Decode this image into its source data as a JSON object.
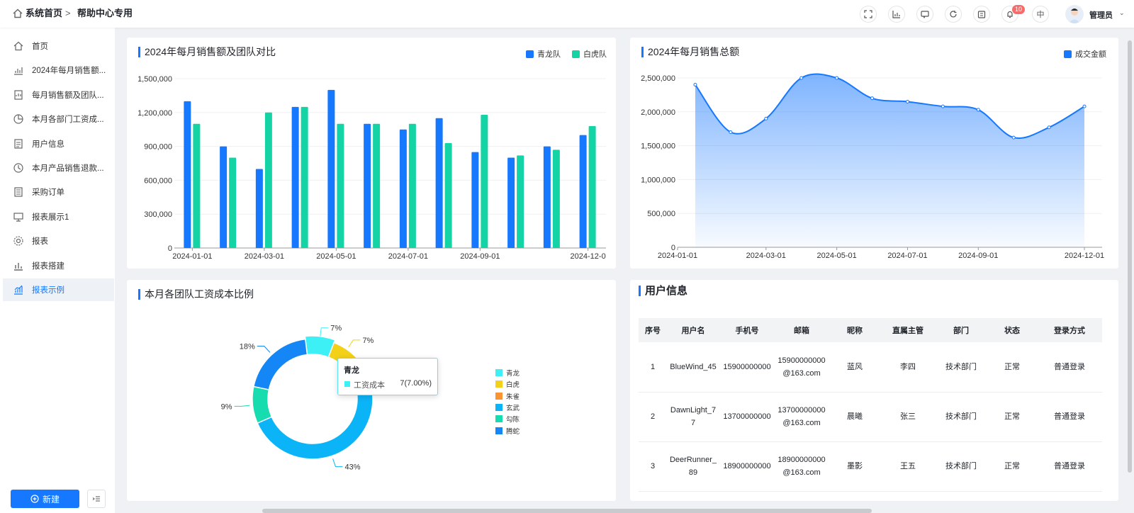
{
  "breadcrumb": {
    "home": "系统首页",
    "current": "帮助中心专用"
  },
  "topbar": {
    "badge_count": "10",
    "lang": "中",
    "user": "管理员"
  },
  "sidebar": {
    "items": [
      {
        "label": "首页",
        "icon": "home-icon"
      },
      {
        "label": "2024年每月销售额...",
        "icon": "bar-chart-icon"
      },
      {
        "label": "每月销售额及团队...",
        "icon": "report-icon"
      },
      {
        "label": "本月各部门工资成...",
        "icon": "pie-chart-icon"
      },
      {
        "label": "用户信息",
        "icon": "user-doc-icon"
      },
      {
        "label": "本月产品销售退款...",
        "icon": "clock-icon"
      },
      {
        "label": "采购订单",
        "icon": "order-icon"
      },
      {
        "label": "报表展示1",
        "icon": "display-icon"
      },
      {
        "label": "报表",
        "icon": "settings-icon"
      },
      {
        "label": "报表搭建",
        "icon": "build-chart-icon"
      },
      {
        "label": "报表示例",
        "icon": "example-chart-icon"
      }
    ],
    "active": 10,
    "new_label": "新建"
  },
  "colors": {
    "accent": "#1677ff",
    "qinglong": "#1677ff",
    "baihu": "#14d3a5"
  },
  "chart_data": [
    {
      "type": "bar",
      "title": "2024年每月销售额及团队对比",
      "categories": [
        "2024-01-01",
        "2024-02-01",
        "2024-03-01",
        "2024-04-01",
        "2024-05-01",
        "2024-06-01",
        "2024-07-01",
        "2024-08-01",
        "2024-09-01",
        "2024-10-01",
        "2024-11-01",
        "2024-12-01"
      ],
      "x_tick_labels": [
        "2024-01-01",
        "2024-03-01",
        "2024-05-01",
        "2024-07-01",
        "2024-09-01",
        "2024-12-0"
      ],
      "y_tick_labels": [
        "0",
        "300,000",
        "600,000",
        "900,000",
        "1,200,000",
        "1,500,000"
      ],
      "ylim": [
        0,
        1500000
      ],
      "legend": "top-right",
      "series": [
        {
          "name": "青龙队",
          "color": "#1677ff",
          "values": [
            1300000,
            900000,
            700000,
            1250000,
            1400000,
            1100000,
            1050000,
            1150000,
            850000,
            800000,
            900000,
            1000000
          ]
        },
        {
          "name": "白虎队",
          "color": "#14d3a5",
          "values": [
            1100000,
            800000,
            1200000,
            1250000,
            1100000,
            1100000,
            1100000,
            930000,
            1180000,
            820000,
            870000,
            1080000
          ]
        }
      ]
    },
    {
      "type": "area",
      "title": "2024年每月销售总额",
      "x": [
        "2024-01-01",
        "2024-02-01",
        "2024-03-01",
        "2024-04-01",
        "2024-05-01",
        "2024-06-01",
        "2024-07-01",
        "2024-08-01",
        "2024-09-01",
        "2024-10-01",
        "2024-11-01",
        "2024-12-01"
      ],
      "x_tick_labels": [
        "2024-01-01",
        "2024-03-01",
        "2024-05-01",
        "2024-07-01",
        "2024-09-01",
        "2024-12-01"
      ],
      "y_tick_labels": [
        "0",
        "500,000",
        "1,000,000",
        "1,500,000",
        "2,000,000",
        "2,500,000"
      ],
      "ylim": [
        0,
        2500000
      ],
      "legend": "top-right",
      "series": [
        {
          "name": "成交金额",
          "color": "#1677ff",
          "values": [
            2400000,
            1700000,
            1900000,
            2500000,
            2500000,
            2200000,
            2150000,
            2080000,
            2030000,
            1620000,
            1770000,
            2080000
          ]
        }
      ]
    },
    {
      "type": "pie",
      "title": "本月各团队工资成本比例",
      "donut": true,
      "slices": [
        {
          "name": "青龙",
          "value": 7,
          "label": "7%",
          "color": "#3cf0f5"
        },
        {
          "name": "白虎",
          "value": 7,
          "label": "7%",
          "color": "#f2d118"
        },
        {
          "name": "朱雀",
          "value": 7,
          "label": "",
          "color": "#fa9433"
        },
        {
          "name": "玄武",
          "value": 43,
          "label": "43%",
          "color": "#0bb4f7"
        },
        {
          "name": "勾陈",
          "value": 9,
          "label": "9%",
          "color": "#17dcaf"
        },
        {
          "name": "腾蛇",
          "value": 18,
          "label": "18%",
          "color": "#1586f5"
        }
      ],
      "tooltip": {
        "title": "青龙",
        "series": "工资成本",
        "value": "7(7.00%)"
      }
    }
  ],
  "user_table": {
    "title": "用户信息",
    "headers": [
      "序号",
      "用户名",
      "手机号",
      "邮箱",
      "昵称",
      "直属主管",
      "部门",
      "状态",
      "登录方式"
    ],
    "rows": [
      [
        "1",
        "BlueWind_45",
        "15900000000",
        "15900000000@163.com",
        "蓝风",
        "李四",
        "技术部门",
        "正常",
        "普通登录"
      ],
      [
        "2",
        "DawnLight_77",
        "13700000000",
        "13700000000@163.com",
        "晨曦",
        "张三",
        "技术部门",
        "正常",
        "普通登录"
      ],
      [
        "3",
        "DeerRunner_89",
        "18900000000",
        "18900000000@163.com",
        "墨影",
        "王五",
        "技术部门",
        "正常",
        "普通登录"
      ]
    ]
  }
}
